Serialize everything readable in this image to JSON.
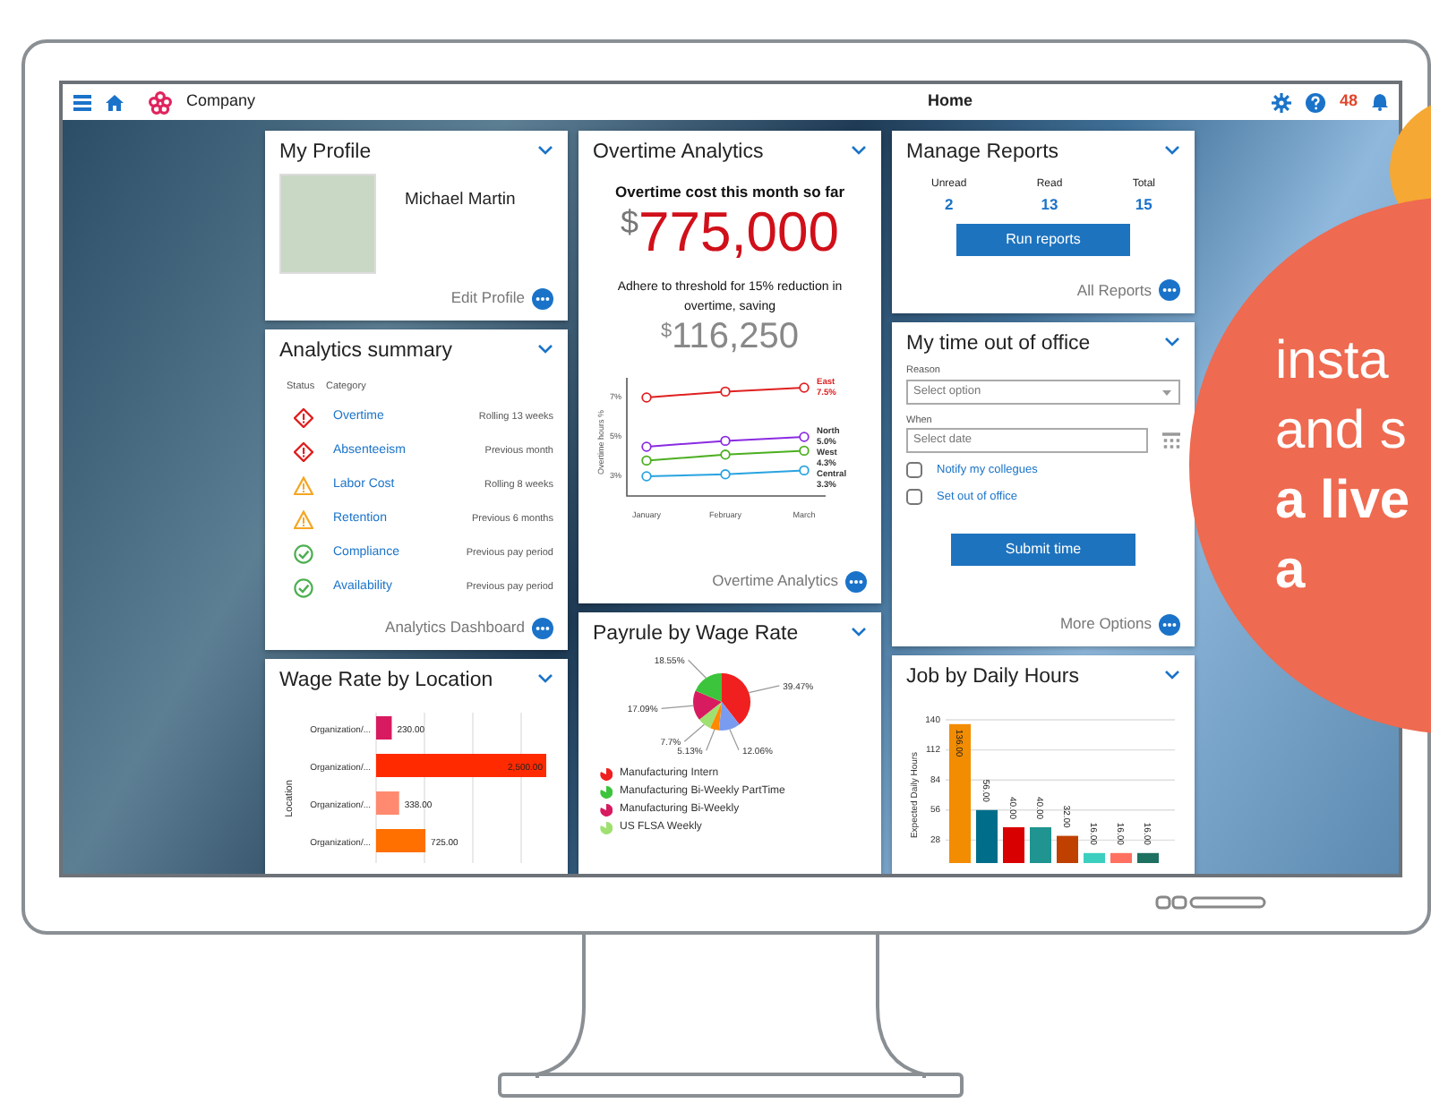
{
  "topbar": {
    "company": "Company",
    "title": "Home",
    "notification_count": "48"
  },
  "profile": {
    "title": "My Profile",
    "name": "Michael Martin",
    "link": "Edit Profile"
  },
  "analytics_summary": {
    "title": "Analytics summary",
    "columns": [
      "Status",
      "Category"
    ],
    "rows": [
      {
        "kind": "alert",
        "category": "Overtime",
        "period": "Rolling 13 weeks"
      },
      {
        "kind": "alert",
        "category": "Absenteeism",
        "period": "Previous month"
      },
      {
        "kind": "warning",
        "category": "Labor Cost",
        "period": "Rolling 8 weeks"
      },
      {
        "kind": "warning",
        "category": "Retention",
        "period": "Previous 6 months"
      },
      {
        "kind": "ok",
        "category": "Compliance",
        "period": "Previous pay period"
      },
      {
        "kind": "ok",
        "category": "Availability",
        "period": "Previous pay period"
      }
    ],
    "link": "Analytics Dashboard"
  },
  "wage_rate": {
    "title": "Wage Rate by Location",
    "chart_data": {
      "type": "bar",
      "orientation": "horizontal",
      "ylabel": "Location",
      "categories": [
        "Organization/...",
        "Organization/...",
        "Organization/...",
        "Organization/..."
      ],
      "values": [
        230,
        2500,
        338,
        725
      ],
      "grid": true,
      "colors": [
        "#d81b60",
        "#ff2a00",
        "#ff8a70",
        "#ff7000"
      ],
      "value_labels": [
        "230.00",
        "2,500.00",
        "338.00",
        "725.00"
      ]
    }
  },
  "overtime": {
    "title": "Overtime Analytics",
    "headline": "Overtime cost this month so far",
    "currency": "$",
    "amount": "775,000",
    "note": "Adhere to threshold for 15% reduction in overtime, saving",
    "saving_currency": "$",
    "saving": "116,250",
    "chart_data": {
      "type": "line",
      "ylabel": "Overtime hours %",
      "categories": [
        "January",
        "February",
        "March"
      ],
      "ylim": [
        2,
        8
      ],
      "yticks": [
        {
          "value": 3,
          "label": "3%"
        },
        {
          "value": 5,
          "label": "5%"
        },
        {
          "value": 7,
          "label": "7%"
        }
      ],
      "series": [
        {
          "name": "East",
          "color": "#e02020",
          "values": [
            7.0,
            7.3,
            7.5
          ],
          "marker": "circle"
        },
        {
          "name": "North",
          "color": "#8a2be2",
          "values": [
            4.5,
            4.8,
            5.0
          ],
          "marker": "circle"
        },
        {
          "name": "West",
          "color": "#4caf20",
          "values": [
            3.8,
            4.1,
            4.3
          ],
          "marker": "circle"
        },
        {
          "name": "Central",
          "color": "#29a3e0",
          "values": [
            3.0,
            3.1,
            3.3
          ],
          "marker": "circle"
        }
      ],
      "annotations": [
        {
          "x": "March",
          "y": 7.5,
          "text": "7.5%"
        },
        {
          "x": "March",
          "y": 5.0,
          "text": "5.0%"
        },
        {
          "x": "March",
          "y": 4.3,
          "text": "4.3%"
        },
        {
          "x": "March",
          "y": 3.3,
          "text": "3.3%"
        }
      ]
    },
    "link": "Overtime Analytics"
  },
  "payrule": {
    "title": "Payrule by Wage Rate",
    "chart_data": {
      "type": "pie",
      "values": [
        39.47,
        12.06,
        5.13,
        7.7,
        17.09,
        18.55
      ],
      "value_labels": [
        "39.47%",
        "12.06%",
        "5.13%",
        "7.7%",
        "17.09%",
        "18.55%"
      ],
      "colors": [
        "#f02020",
        "#7a9cf0",
        "#ff8a00",
        "#a0e070",
        "#d81b60",
        "#3cc43c"
      ]
    },
    "legend": [
      {
        "label": "Manufacturing Intern",
        "color": "#f02020"
      },
      {
        "label": "Manufacturing Bi-Weekly PartTime",
        "color": "#3cc43c"
      },
      {
        "label": "Manufacturing Bi-Weekly",
        "color": "#d81b60"
      },
      {
        "label": "US FLSA Weekly",
        "color": "#a0e070"
      }
    ]
  },
  "reports": {
    "title": "Manage Reports",
    "stats": [
      {
        "label": "Unread",
        "value": "2"
      },
      {
        "label": "Read",
        "value": "13"
      },
      {
        "label": "Total",
        "value": "15"
      }
    ],
    "button": "Run reports",
    "link": "All Reports"
  },
  "time_off": {
    "title": "My time out of office",
    "reason_label": "Reason",
    "reason_placeholder": "Select option",
    "when_label": "When",
    "when_placeholder": "Select date",
    "options": [
      {
        "label": "Notify my collegues",
        "checked": false
      },
      {
        "label": "Set out of office",
        "checked": false
      }
    ],
    "button": "Submit time",
    "link": "More Options"
  },
  "job_hours": {
    "title": "Job by Daily Hours",
    "chart_data": {
      "type": "bar",
      "ylabel": "Expected Daily Hours",
      "yticks": [
        28,
        56,
        84,
        112,
        140
      ],
      "ylim": [
        0,
        140
      ],
      "values": [
        136,
        56,
        40,
        40,
        32,
        16,
        16,
        16
      ],
      "grid": true,
      "colors": [
        "#f28c00",
        "#006e8a",
        "#d80000",
        "#1f9490",
        "#c04000",
        "#3ccfbf",
        "#ff7060",
        "#1e7060"
      ],
      "value_labels": [
        "136.00",
        "56.00",
        "40.00",
        "40.00",
        "32.00",
        "16.00",
        "16.00",
        "16.00"
      ]
    }
  },
  "promo": {
    "lines": [
      {
        "text": "insta",
        "bold": false
      },
      {
        "text": "and s",
        "bold": false
      },
      {
        "text": "a live",
        "bold": true
      },
      {
        "text": "a",
        "bold": true
      }
    ]
  }
}
